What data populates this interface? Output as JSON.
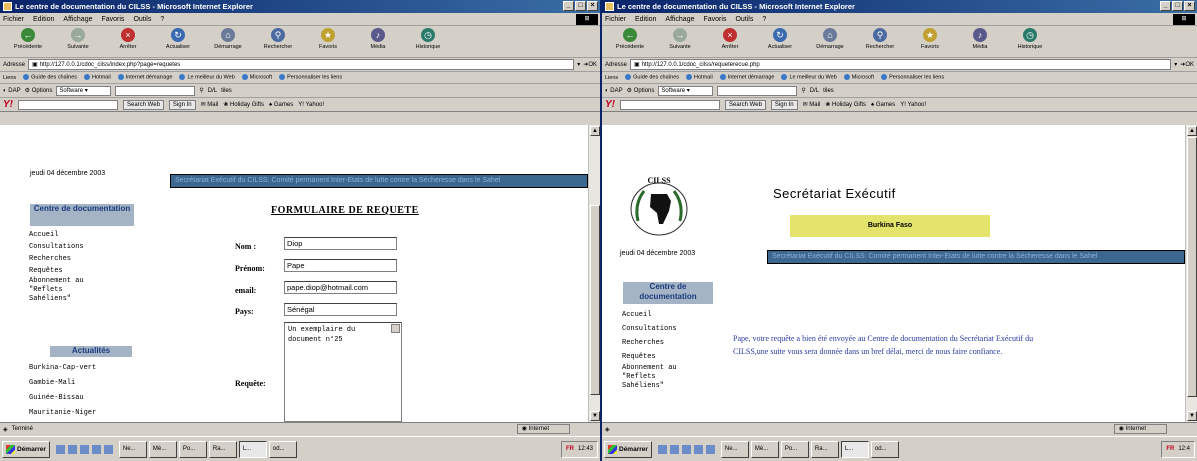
{
  "w1": {
    "title": "Le centre de documentation du CILSS - Microsoft Internet Explorer",
    "menu": [
      "Fichier",
      "Edition",
      "Affichage",
      "Favoris",
      "Outils",
      "?"
    ],
    "buttons": [
      "Précédente",
      "Suivante",
      "Arrêter",
      "Actualiser",
      "Démarrage",
      "Rechercher",
      "Favoris",
      "Média",
      "Historique"
    ],
    "address_label": "Adresse",
    "url": "http://127.0.0.1/cdoc_cilss/index.php?page=requetes",
    "go": "OK",
    "links": [
      "Liens",
      "Guide des chaînes",
      "Hotmail",
      "Internet démarrage",
      "Le meilleur du Web",
      "Microsoft",
      "Personnaliser les liens"
    ],
    "toolbar_row": {
      "dap": "DAP",
      "options": "Options",
      "software": "Software",
      "dl": "D/L",
      "tiles": "tiles"
    },
    "yahoo": {
      "search": "Search Web",
      "signin": "Sign In",
      "mail": "Mail",
      "holiday": "Holiday Gifts",
      "games": "Games",
      "yahoo": "Yahoo!"
    },
    "page": {
      "date": "jeudi 04 décembre 2003",
      "banner": "Secrétariat Exécutif du CILSS: Comité permanent Inter-Etats de lutte contre la Sécheresse dans le Sahel",
      "nav_header": "Centre de documentation",
      "nav": [
        "Accueil",
        "Consultations",
        "Recherches",
        "Requêtes",
        "Abonnement au",
        "\"Reflets",
        "Sahéliens\""
      ],
      "news_header": "Actualités",
      "news": [
        "Burkina-Cap-vert",
        "Gambie-Mali",
        "Guinée-Bissau",
        "Mauritanie-Niger"
      ],
      "form_title": "FORMULAIRE DE REQUETE",
      "labels": {
        "nom": "Nom :",
        "prenom": "Prénom:",
        "email": "email:",
        "pays": "Pays:",
        "requete": "Requête:"
      },
      "values": {
        "nom": "Diop",
        "prenom": "Pape",
        "email": "pape.diop@hotmail.com",
        "pays": "Sénégal",
        "requete_l1": "Un exemplaire du",
        "requete_l2": "document n°25"
      }
    },
    "status": {
      "left": "Terminé",
      "zone": "Internet"
    }
  },
  "w2": {
    "title": "Le centre de documentation du CILSS - Microsoft Internet Explorer",
    "menu": [
      "Fichier",
      "Edition",
      "Affichage",
      "Favoris",
      "Outils",
      "?"
    ],
    "buttons": [
      "Précédente",
      "Suivante",
      "Arrêter",
      "Actualiser",
      "Démarrage",
      "Rechercher",
      "Favoris",
      "Média",
      "Historique"
    ],
    "address_label": "Adresse",
    "url": "http://127.0.0.1/cdoc_cilss/requeterecue.php",
    "go": "OK",
    "links": [
      "Liens",
      "Guide des chaînes",
      "Hotmail",
      "Internet démarrage",
      "Le meilleur du Web",
      "Microsoft",
      "Personnaliser les liens"
    ],
    "toolbar_row": {
      "dap": "DAP",
      "options": "Options",
      "software": "Software",
      "dl": "D/L",
      "tiles": "tiles"
    },
    "yahoo": {
      "search": "Search Web",
      "signin": "Sign In",
      "mail": "Mail",
      "holiday": "Holiday Gifts",
      "games": "Games",
      "yahoo": "Yahoo!"
    },
    "page": {
      "logo_text": "CILSS",
      "secretariat": "Secrétariat Exécutif",
      "country": "Burkina Faso",
      "date": "jeudi 04 décembre 2003",
      "banner": "Secrétariat Exécutif du CILSS: Comité permanent Inter-Etats de lutte contre la Sécheresse dans le Sahel",
      "nav_header": "Centre de documentation",
      "nav": [
        "Accueil",
        "Consultations",
        "Recherches",
        "Requêtes",
        "Abonnement au",
        "\"Reflets",
        "Sahéliens\""
      ],
      "message_l1": "Pape, votre requête a bien été envoyée au Centre de documentation du Secrétariat Exécutif du",
      "message_l2": "CILSS,une suite vous sera donnée dans un bref délai, merci de nous faire confiance."
    },
    "status": {
      "left": "",
      "zone": "Internet"
    }
  },
  "taskbar": {
    "start": "Démarrer",
    "tasks1": [
      "Ne...",
      "Mé...",
      "Po...",
      "Ra...",
      "L...",
      "od..."
    ],
    "tasks2": [
      "Ne...",
      "Mé...",
      "Po...",
      "Ra...",
      "L...",
      "od..."
    ],
    "clock1": "12:43",
    "clock2": "12:4",
    "tray_text": "FR"
  },
  "colors": {
    "titlebar": "#0a246a",
    "banner": "#3c6890",
    "nav_header": "#a4b4c4",
    "country_bg": "#e4e46c",
    "message": "#2a3aa0"
  }
}
